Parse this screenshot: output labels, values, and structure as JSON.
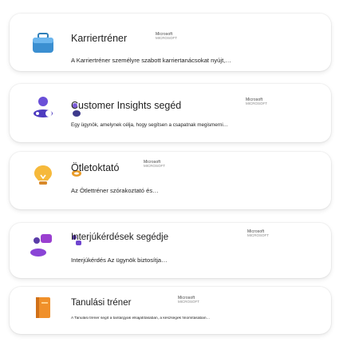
{
  "agents": [
    {
      "title": "Karriertréner",
      "publisher": "Microsoft",
      "publisher_sub": "MICROSOFT",
      "description": "A Karriertréner személyre szabott karriertanácsokat nyújt,…",
      "icon": "briefcase-icon"
    },
    {
      "title": "Customer Insights segéd",
      "publisher": "Microsoft",
      "publisher_sub": "MICROSOFT",
      "description": "Egy ügynök, amelynek célja, hogy segítsen a csapatnak megismerni…",
      "icon": "people-icon"
    },
    {
      "title": "Ötletoktató",
      "publisher": "Microsoft",
      "publisher_sub": "MICROSOFT",
      "description": "Az Ötlettréner szórakoztató és…",
      "icon": "lightbulb-icon"
    },
    {
      "title": "Interjúkérdések segédje",
      "publisher": "Microsoft",
      "publisher_sub": "MICROSOFT",
      "description": "Interjúkérdés Az ügynök biztosítja…",
      "icon": "chat-bubbles-icon"
    },
    {
      "title": "Tanulási tréner",
      "publisher": "Microsoft",
      "publisher_sub": "MICROSOFT",
      "description": "A Tanulási tréner segít a tantárgyak elsajátításában, a készségek finomításában…",
      "icon": "book-icon"
    }
  ]
}
